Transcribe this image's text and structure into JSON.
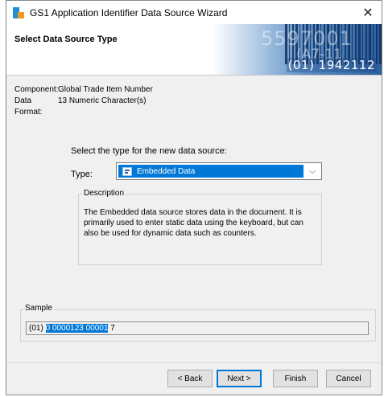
{
  "window": {
    "title": "GS1 Application Identifier Data Source Wizard",
    "close_glyph": "✕"
  },
  "header": {
    "title": "Select Data Source Type",
    "banner_text": "(01) 1942112",
    "banner_ghost_1": "5597001",
    "banner_ghost_2": "(A7-11"
  },
  "info": {
    "component_label": "Component:",
    "component_value": "Global Trade Item Number",
    "format_label": "Data Format:",
    "format_value": "13 Numeric Character(s)"
  },
  "type_section": {
    "prompt": "Select the type for the new data source:",
    "type_label": "Type:",
    "selected_value": "Embedded Data",
    "selected_icon": "embedded-data-icon",
    "dropdown_glyph": "⌵"
  },
  "description": {
    "title": "Description",
    "text": "The Embedded data source stores data in the document.  It is primarily used to enter static data using the keyboard, but can also be used for dynamic data such as counters."
  },
  "sample": {
    "title": "Sample",
    "prefix": "(01) ",
    "highlighted": "0 0000123 00001",
    "suffix": " 7"
  },
  "buttons": {
    "back": "< Back",
    "next": "Next >",
    "finish": "Finish",
    "cancel": "Cancel"
  },
  "colors": {
    "selection": "#0078d7",
    "dialog_bg": "#f0f0f0",
    "default_button_border": "#0078d7"
  }
}
